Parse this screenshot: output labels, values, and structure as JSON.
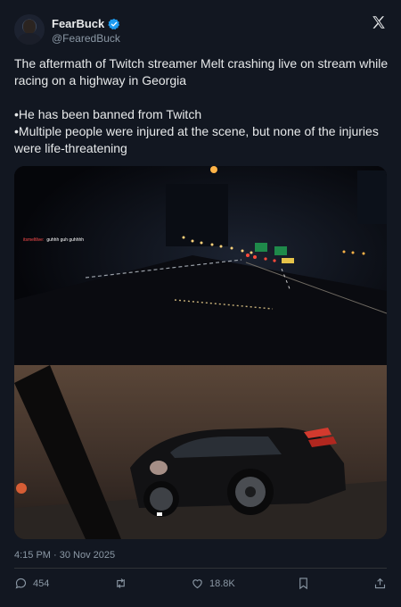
{
  "author": {
    "name": "FearBuck",
    "handle": "@FearedBuck",
    "avatar_icon": "profile-photo",
    "verified_icon": "verified-badge-icon"
  },
  "tweet": {
    "line1": "The aftermath of Twitch streamer Melt crashing live on stream while racing on a highway in Georgia",
    "bullet1": "•He has been banned from Twitch",
    "bullet2": "•Multiple people were injured at the scene, but none of the injuries were life-threatening"
  },
  "media": {
    "overlay_user": "itsmeltlive:",
    "overlay_text": "guhhh guh guhhhh"
  },
  "timestamp": "4:15 PM · 30 Nov 2025",
  "actions": {
    "replies": "454",
    "retweets": "",
    "likes": "18.8K"
  },
  "colors": {
    "background": "#121721",
    "text": "#e7e9ea",
    "muted": "#8b98a5",
    "verified": "#1d9bf0"
  }
}
